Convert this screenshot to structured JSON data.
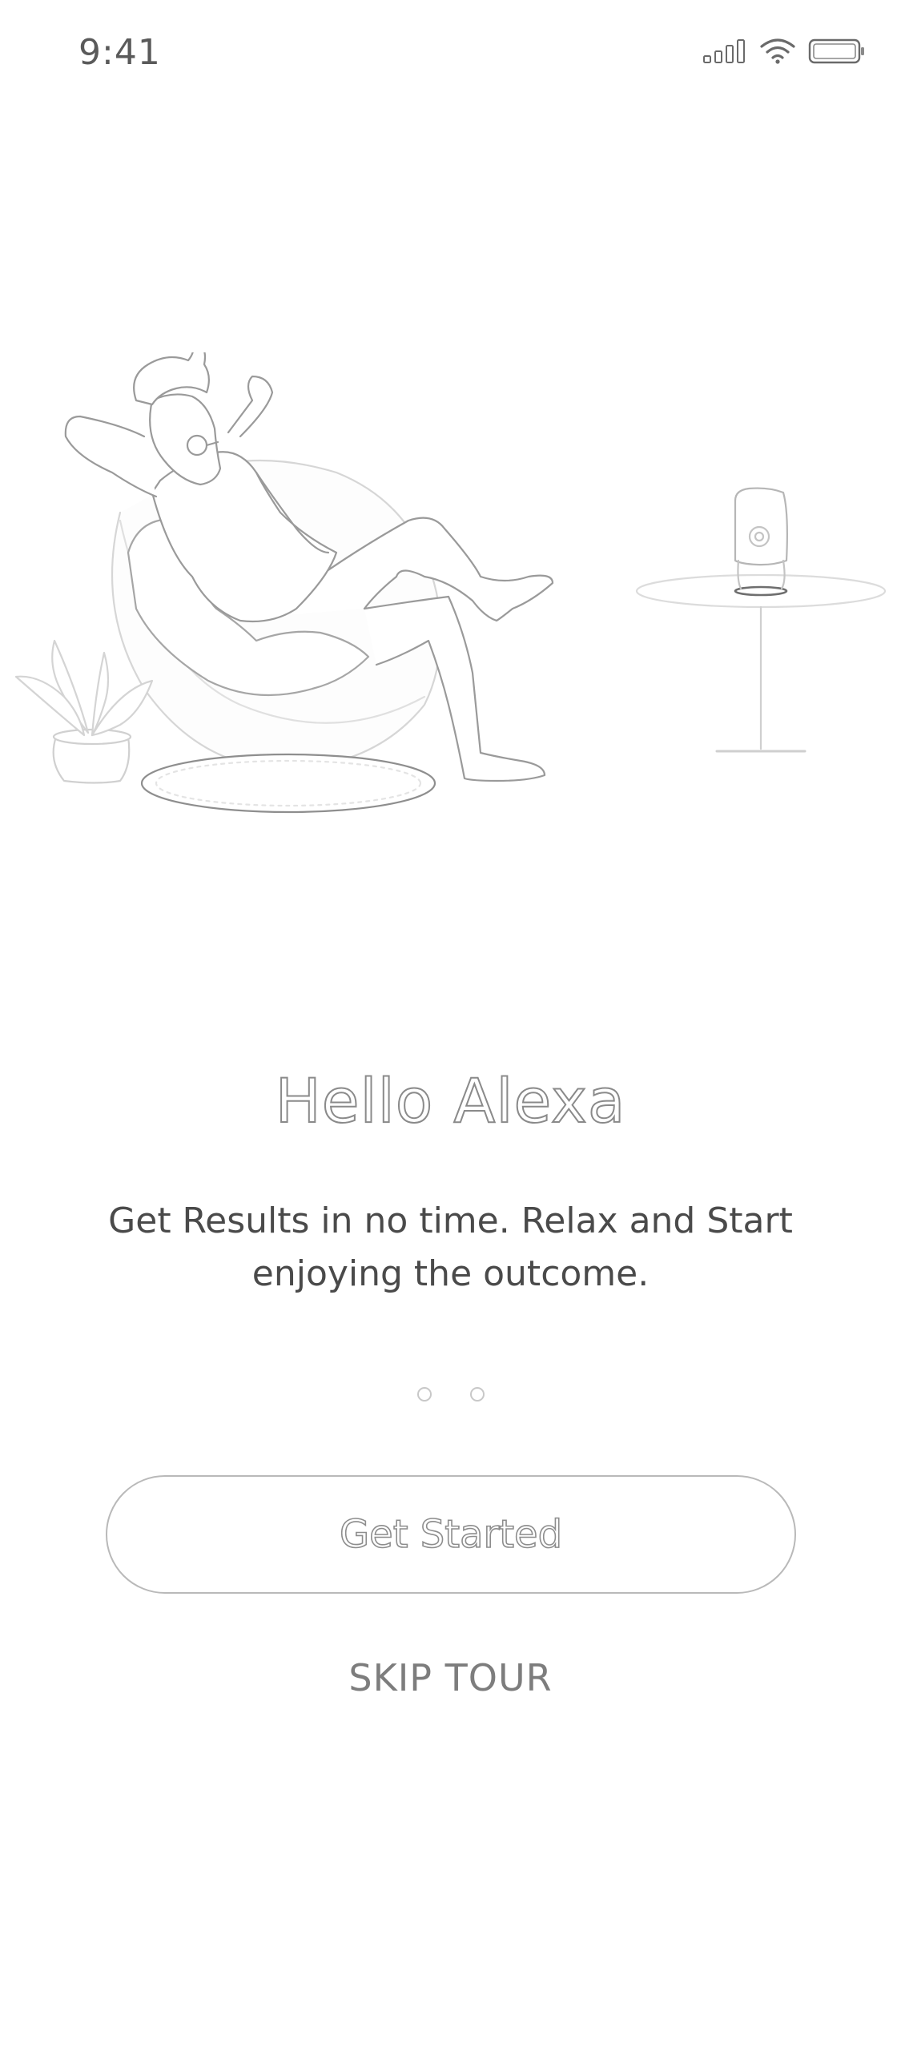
{
  "status_bar": {
    "time": "9:41",
    "icons": [
      "cellular-signal-icon",
      "wifi-icon",
      "battery-icon"
    ]
  },
  "illustration": {
    "name": "man-relaxing-in-chair-with-smart-speaker"
  },
  "onboarding": {
    "title": "Hello Alexa",
    "subtitle": "Get Results in no time. Relax and Start enjoying the outcome.",
    "pages": 2,
    "current_page": 1
  },
  "actions": {
    "get_started_label": "Get Started",
    "skip_label": "SKIP TOUR"
  },
  "colors": {
    "background": "#ffffff",
    "outline": "#8a8a8a",
    "text": "#4a4a4a"
  }
}
